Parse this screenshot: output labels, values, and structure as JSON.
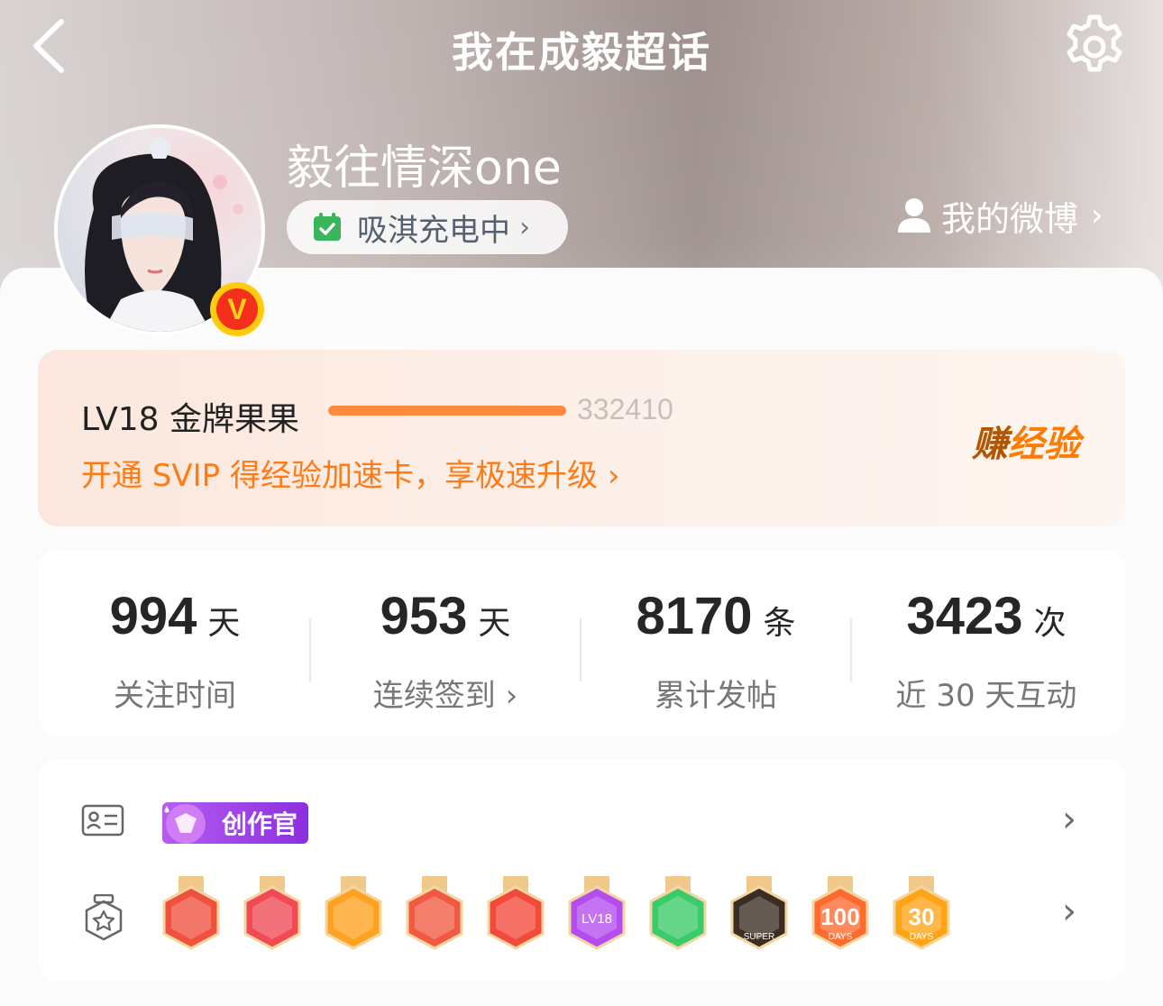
{
  "nav": {
    "title": "我在成毅超话"
  },
  "profile": {
    "username": "毅往情深one",
    "status_label": "吸淇充电中",
    "my_weibo_label": "我的微博",
    "verified_badge": "V"
  },
  "level": {
    "title": "LV18 金牌果果",
    "points": "332410",
    "progress": 1.0,
    "promo": "开通 SVIP 得经验加速卡，享极速升级",
    "earn_label_first": "赚",
    "earn_label_rest": "经验"
  },
  "stats": [
    {
      "value": "994",
      "unit": "天",
      "label": "关注时间",
      "has_arrow": false
    },
    {
      "value": "953",
      "unit": "天",
      "label": "连续签到",
      "has_arrow": true
    },
    {
      "value": "8170",
      "unit": "条",
      "label": "累计发帖",
      "has_arrow": false
    },
    {
      "value": "3423",
      "unit": "次",
      "label": "近 30 天互动",
      "has_arrow": false
    }
  ],
  "badges": {
    "creator_label": "创作官",
    "medal_colors": [
      "#f0513e",
      "#f04a55",
      "#ffa21f",
      "#f05a43",
      "#f24a3a",
      "#b44cf0",
      "#3ccb6b",
      "#3b2d22",
      "#ff6a2e",
      "#ffa415"
    ],
    "medal_texts": [
      "",
      "",
      "",
      "",
      "",
      "LV18",
      "",
      "SUPER",
      "DAYS",
      "DAYS"
    ],
    "medal_numbers": [
      "",
      "",
      "",
      "",
      "",
      "",
      "",
      "",
      "100",
      "30"
    ]
  },
  "colors": {
    "accent_orange": "#ff7b16",
    "progress_fill": "#ff8a3d"
  }
}
